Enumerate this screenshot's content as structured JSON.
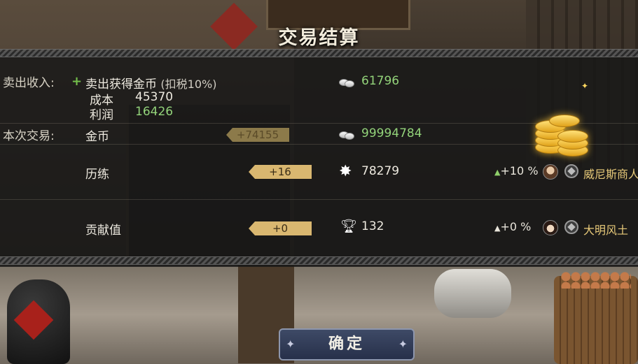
{
  "title": "交易结算",
  "sale_income": {
    "label": "卖出收入:",
    "item_label": "卖出获得金币",
    "tax_note": "(扣税10%)",
    "amount": "61796",
    "cost_label": "成本",
    "cost_value": "45370",
    "profit_label": "利润",
    "profit_value": "16426"
  },
  "this_trade": {
    "label": "本次交易:",
    "rows": [
      {
        "name": "金币",
        "change": "+74155",
        "icon": "coins-icon",
        "total": "99994784"
      },
      {
        "name": "历练",
        "change": "+16",
        "icon": "sparkle-star-icon",
        "total": "78279",
        "bonus": "+10 %",
        "merchant": "威尼斯商人"
      },
      {
        "name": "贡献值",
        "change": "+0",
        "icon": "trophy-icon",
        "total": "132",
        "bonus": "+0 %",
        "merchant": "大明风土"
      }
    ]
  },
  "confirm_button": {
    "label": "确定"
  },
  "colors": {
    "positive_green": "#93d37a",
    "tag_gold": "#d9b770",
    "merchant_gold": "#e7c979",
    "button_blue": "#2f3a55"
  }
}
